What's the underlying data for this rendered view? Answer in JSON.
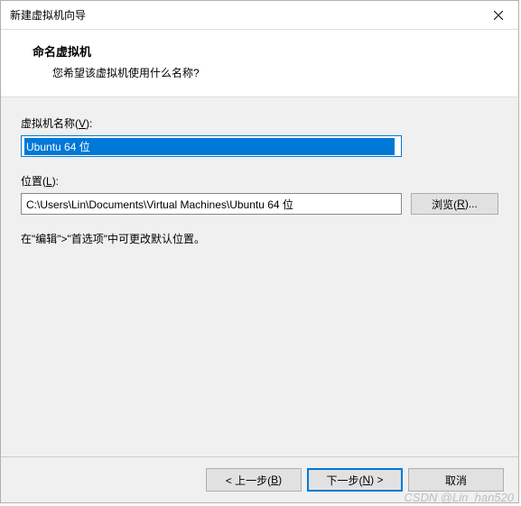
{
  "window": {
    "title": "新建虚拟机向导"
  },
  "header": {
    "title": "命名虚拟机",
    "subtitle": "您希望该虚拟机使用什么名称?"
  },
  "fields": {
    "name": {
      "label_prefix": "虚拟机名称(",
      "label_key": "V",
      "label_suffix": "):",
      "value": "Ubuntu 64 位"
    },
    "location": {
      "label_prefix": "位置(",
      "label_key": "L",
      "label_suffix": "):",
      "value": "C:\\Users\\Lin\\Documents\\Virtual Machines\\Ubuntu 64 位",
      "browse_prefix": "浏览(",
      "browse_key": "R",
      "browse_suffix": ")..."
    },
    "hint": "在\"编辑\">\"首选项\"中可更改默认位置。"
  },
  "footer": {
    "back_prefix": "< 上一步(",
    "back_key": "B",
    "back_suffix": ")",
    "next_prefix": "下一步(",
    "next_key": "N",
    "next_suffix": ") >",
    "cancel": "取消"
  },
  "watermark": "CSDN @Lin_han520"
}
